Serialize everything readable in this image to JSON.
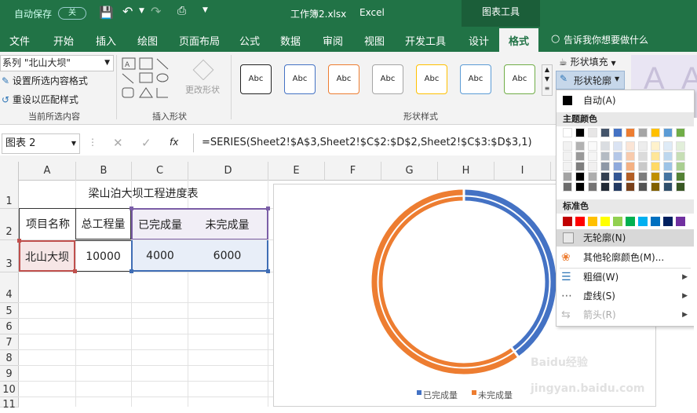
{
  "titlebar": {
    "autosave": "自动保存",
    "autosave_state": "关",
    "filename": "工作簿2.xlsx",
    "app": "Excel",
    "context_tab": "图表工具"
  },
  "tabs": [
    "文件",
    "开始",
    "插入",
    "绘图",
    "页面布局",
    "公式",
    "数据",
    "审阅",
    "视图",
    "开发工具",
    "设计",
    "格式"
  ],
  "tell_me": "告诉我你想要做什么",
  "ribbon": {
    "selection_value": "系列 \"北山大坝\"",
    "format_selection": "设置所选内容格式",
    "reset_style": "重设以匹配样式",
    "group1_label": "当前所选内容",
    "group2_label": "插入形状",
    "change_shape": "更改形状",
    "shape_sample": "Abc",
    "group3_label": "形状样式",
    "shape_fill": "形状填充",
    "shape_outline": "形状轮廓"
  },
  "formula": {
    "namebox": "图表 2",
    "fx": "fx",
    "text": "=SERIES(Sheet2!$A$3,Sheet2!$C$2:$D$2,Sheet2!$C$3:$D$3,1)"
  },
  "columns": [
    "A",
    "B",
    "C",
    "D",
    "E",
    "F",
    "G",
    "H",
    "I"
  ],
  "rows": [
    "1",
    "2",
    "3",
    "4",
    "5",
    "6",
    "7",
    "8",
    "9",
    "10",
    "11"
  ],
  "sheet": {
    "title": "梁山泊大坝工程进度表",
    "headers": [
      "项目名称",
      "总工程量",
      "已完成量",
      "未完成量"
    ],
    "row3": [
      "北山大坝",
      "10000",
      "4000",
      "6000"
    ]
  },
  "chart_data": {
    "type": "pie",
    "style": "doughnut",
    "categories": [
      "已完成量",
      "未完成量"
    ],
    "values": [
      4000,
      6000
    ],
    "colors": [
      "#4472c4",
      "#ed7d31"
    ]
  },
  "menu": {
    "auto": "自动(A)",
    "theme_colors": "主题颜色",
    "standard_colors": "标准色",
    "no_outline": "无轮廓(N)",
    "more_colors": "其他轮廓颜色(M)...",
    "weight": "粗细(W)",
    "dashes": "虚线(S)",
    "arrows": "箭头(R)",
    "theme_top": [
      "#ffffff",
      "#000000",
      "#e7e6e6",
      "#44546a",
      "#4472c4",
      "#ed7d31",
      "#a5a5a5",
      "#ffc000",
      "#5b9bd5",
      "#70ad47"
    ],
    "standard": [
      "#c00000",
      "#ff0000",
      "#ffc000",
      "#ffff00",
      "#92d050",
      "#00b050",
      "#00b0f0",
      "#0070c0",
      "#002060",
      "#7030a0"
    ]
  },
  "watermark": "Baidu经验 jingyan.baidu.com"
}
